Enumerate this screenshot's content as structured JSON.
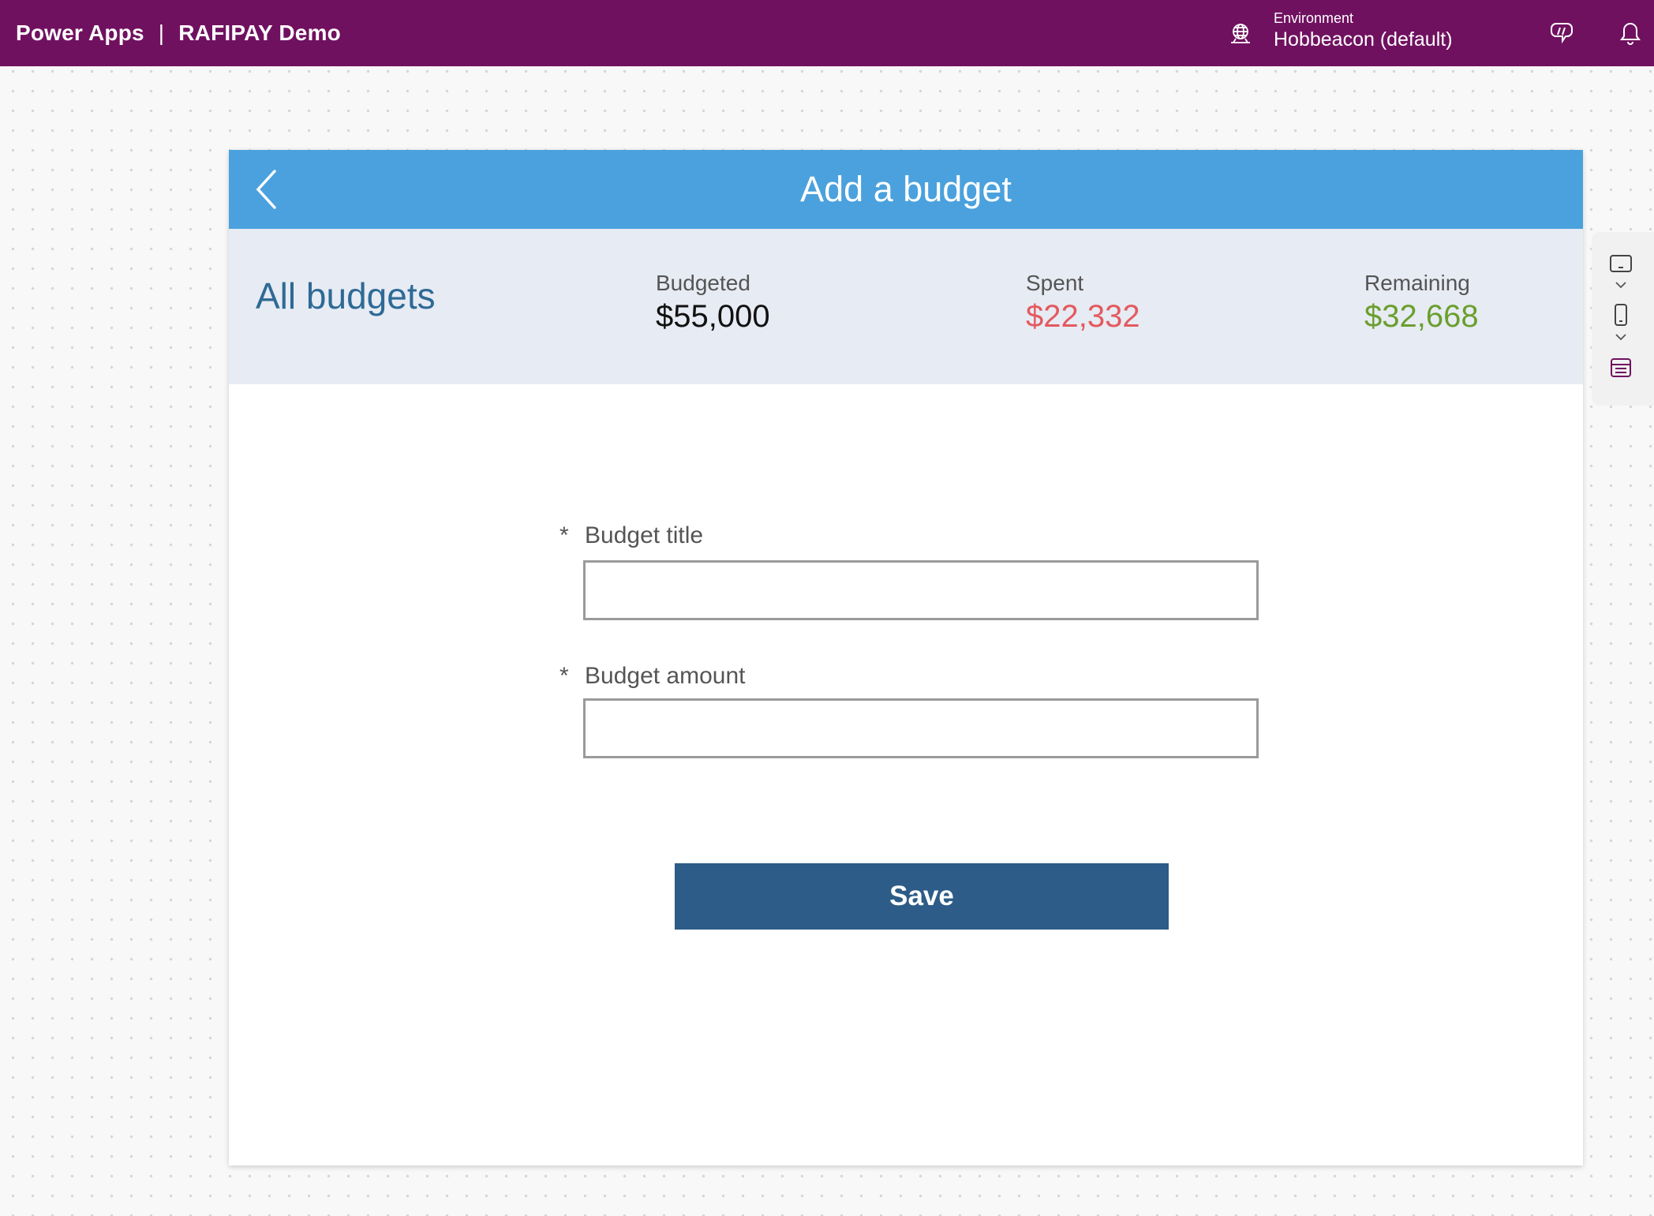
{
  "topbar": {
    "product": "Power Apps",
    "separator": "|",
    "app_name": "RAFIPAY Demo",
    "environment_label": "Environment",
    "environment_name": "Hobbeacon (default)",
    "icons": [
      "environment-globe-icon",
      "copilot-icon",
      "notifications-bell-icon"
    ]
  },
  "app": {
    "title": "Add a budget",
    "back_icon": "chevron-left-icon",
    "summary": {
      "heading": "All budgets",
      "budgeted_label": "Budgeted",
      "budgeted_value": "$55,000",
      "spent_label": "Spent",
      "spent_value": "$22,332",
      "remaining_label": "Remaining",
      "remaining_value": "$32,668"
    },
    "form": {
      "required_marker": "*",
      "title_label": "Budget title",
      "title_value": "",
      "amount_label": "Budget amount",
      "amount_value": ""
    },
    "save_label": "Save"
  },
  "side_toolbar": {
    "icons": [
      "tablet-landscape-icon",
      "chevron-down-icon",
      "phone-portrait-icon",
      "chevron-down-icon",
      "data-table-icon"
    ]
  },
  "colors": {
    "topbar": "#701160",
    "app_header": "#4aa1dd",
    "summary_bg": "#e7ebf3",
    "heading": "#2e6a96",
    "spent": "#e35a5f",
    "remaining": "#6a9f2d",
    "save_button": "#2c5c87"
  }
}
